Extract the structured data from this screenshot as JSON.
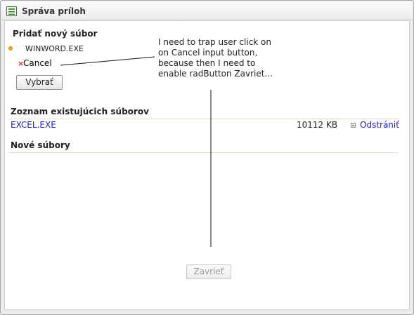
{
  "window": {
    "title": "Správa príloh",
    "title_icon": "list-window-icon"
  },
  "upload": {
    "title": "Pridať nový súbor",
    "selected_file": "WINWORD.EXE",
    "cancel_label": "Cancel",
    "choose_button": "Vybrať"
  },
  "existing": {
    "title": "Zoznam existujúcich súborov",
    "files": [
      {
        "name": "EXCEL.EXE",
        "size": "10112 KB",
        "action": "Odstrániť"
      }
    ]
  },
  "new_files": {
    "title": "Nové súbory"
  },
  "annotation": {
    "text": "I need to trap user click on on Cancel input button, because then I need to enable radButton Zavriet..."
  },
  "footer": {
    "close_button": "Zavrieť"
  }
}
